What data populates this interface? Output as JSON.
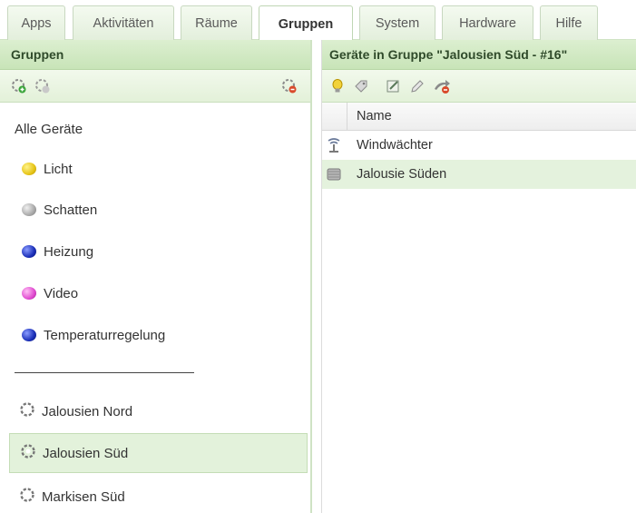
{
  "tabs": [
    {
      "label": "Apps",
      "active": false
    },
    {
      "label": "Aktivitäten",
      "active": false
    },
    {
      "label": "Räume",
      "active": false
    },
    {
      "label": "Gruppen",
      "active": true
    },
    {
      "label": "System",
      "active": false
    },
    {
      "label": "Hardware",
      "active": false
    },
    {
      "label": "Hilfe",
      "active": false
    }
  ],
  "left_panel": {
    "title": "Gruppen",
    "toolbar_icons": [
      "add-group-icon",
      "edit-group-icon",
      "delete-group-icon"
    ],
    "all_devices_label": "Alle Geräte",
    "categories": [
      {
        "label": "Licht",
        "color": "#e6c417",
        "icon": "yellow-ball-icon"
      },
      {
        "label": "Schatten",
        "color": "#a9a9a9",
        "icon": "gray-ball-icon"
      },
      {
        "label": "Heizung",
        "color": "#1b2fb8",
        "icon": "blue-ball-icon"
      },
      {
        "label": "Video",
        "color": "#e04bd0",
        "icon": "pink-ball-icon"
      },
      {
        "label": "Temperaturregelung",
        "color": "#1b2fb8",
        "icon": "blue-ball-icon"
      }
    ],
    "groups": [
      {
        "label": "Jalousien Nord",
        "selected": false,
        "icon": "gear-icon"
      },
      {
        "label": "Jalousien Süd",
        "selected": true,
        "icon": "gear-icon"
      },
      {
        "label": "Markisen Süd",
        "selected": false,
        "icon": "gear-icon"
      }
    ]
  },
  "right_panel": {
    "title": "Geräte in Gruppe \"Jalousien Süd - #16\"",
    "toolbar_icons": [
      "bulb-icon",
      "tag-icon",
      "edit-icon",
      "pencil-icon",
      "remove-arrow-icon"
    ],
    "column_header": "Name",
    "rows": [
      {
        "label": "Windwächter",
        "icon": "wind-sensor-icon",
        "selected": false
      },
      {
        "label": "Jalousie Süden",
        "icon": "jalousie-icon",
        "selected": true
      }
    ]
  },
  "colors": {
    "header_green": "#c8e4b8",
    "selection_green": "#e3f2db"
  }
}
